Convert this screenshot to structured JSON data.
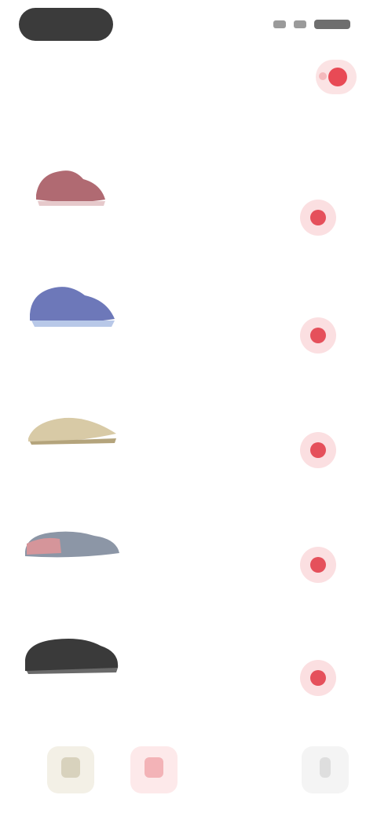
{
  "status_bar": {
    "time": "",
    "battery_level": 1.0
  },
  "header": {
    "title": "",
    "cart_icon": "cart-icon"
  },
  "products": [
    {
      "name": "",
      "meta": "",
      "rating": "",
      "price": "",
      "image_color": "#b06a72",
      "add_icon": "plus-icon"
    },
    {
      "name": "",
      "meta": "",
      "rating": "",
      "price": "",
      "image_color": "#6d78b9",
      "add_icon": "plus-icon"
    },
    {
      "name": "",
      "meta": "",
      "rating": "",
      "price": "",
      "image_color": "#d8caa6",
      "add_icon": "plus-icon"
    },
    {
      "name": "",
      "meta": "",
      "rating": "",
      "price": "",
      "image_color": "#8c96a6",
      "add_icon": "plus-icon"
    },
    {
      "name": "",
      "meta": "",
      "rating": "",
      "price": "",
      "image_color": "#3a3a3a",
      "add_icon": "plus-icon"
    },
    {
      "name": "",
      "meta": "",
      "rating": "",
      "price": "",
      "image_color": "#cccccc",
      "add_icon": "plus-icon"
    }
  ],
  "bottom_nav": [
    {
      "label": "",
      "icon": "home-icon"
    },
    {
      "label": "",
      "icon": "orders-icon"
    },
    {
      "label": "",
      "icon": "profile-icon"
    }
  ],
  "colors": {
    "accent": "#e84a55",
    "accent_light": "#fbdfe1",
    "background": "#ffffff"
  }
}
